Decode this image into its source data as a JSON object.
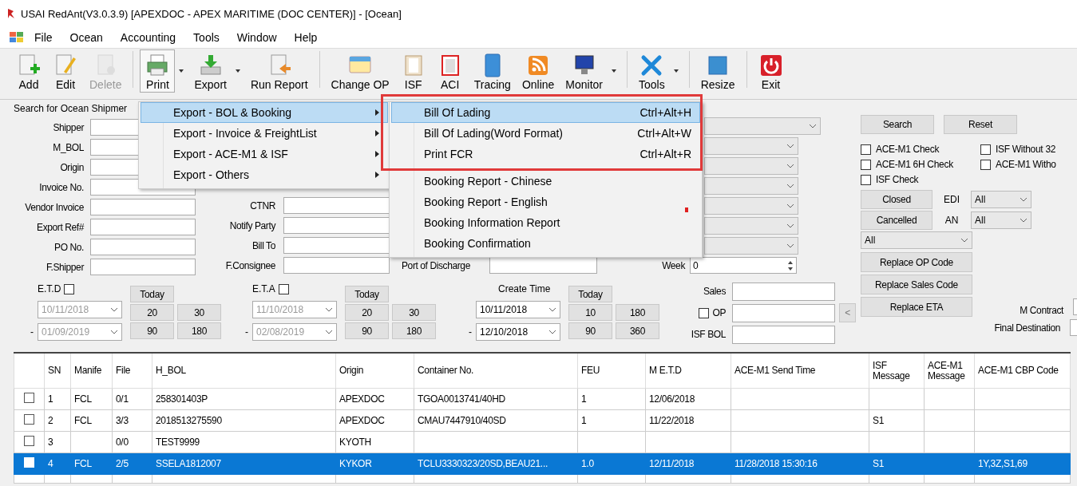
{
  "window": {
    "title": "USAI RedAnt(V3.0.3.9) [APEXDOC - APEX MARITIME (DOC CENTER)] - [Ocean]"
  },
  "menu_bar": [
    "File",
    "Ocean",
    "Accounting",
    "Tools",
    "Window",
    "Help"
  ],
  "toolbar": [
    {
      "label": "Add",
      "disabled": false,
      "pressed": false,
      "dropdown": false
    },
    {
      "label": "Edit",
      "disabled": false,
      "pressed": false,
      "dropdown": false
    },
    {
      "label": "Delete",
      "disabled": true,
      "pressed": false,
      "dropdown": false
    },
    {
      "label": "Print",
      "disabled": false,
      "pressed": true,
      "dropdown": true
    },
    {
      "label": "Export",
      "disabled": false,
      "pressed": false,
      "dropdown": true
    },
    {
      "label": "Run Report",
      "disabled": false,
      "pressed": false,
      "dropdown": false
    },
    {
      "label": "Change OP",
      "disabled": false,
      "pressed": false,
      "dropdown": false
    },
    {
      "label": "ISF",
      "disabled": false,
      "pressed": false,
      "dropdown": false
    },
    {
      "label": "ACI",
      "disabled": false,
      "pressed": false,
      "dropdown": false
    },
    {
      "label": "Tracing",
      "disabled": false,
      "pressed": false,
      "dropdown": false
    },
    {
      "label": "Online",
      "disabled": false,
      "pressed": false,
      "dropdown": false
    },
    {
      "label": "Monitor",
      "disabled": false,
      "pressed": false,
      "dropdown": true
    },
    {
      "label": "Tools",
      "disabled": false,
      "pressed": false,
      "dropdown": true
    },
    {
      "label": "Resize",
      "disabled": false,
      "pressed": false,
      "dropdown": false
    },
    {
      "label": "Exit",
      "disabled": false,
      "pressed": false,
      "dropdown": false
    }
  ],
  "search_form": {
    "title": "Search for Ocean Shipmer",
    "left_fields": [
      "Shipper",
      "M_BOL",
      "Origin",
      "Invoice No.",
      "Vendor Invoice",
      "Export Ref#",
      "PO No.",
      "F.Shipper"
    ],
    "middle_fields": [
      "CTNR",
      "Notify Party",
      "Bill To",
      "F.Consignee"
    ],
    "port_of_discharge": "Port of Discharge",
    "week": {
      "label": "Week",
      "value": "0"
    },
    "date_groups": [
      {
        "kind": "checkbox",
        "label": "E.T.D",
        "checked": false,
        "disabled": true,
        "from": "10/11/2018",
        "separator": "-",
        "to": "01/09/2019",
        "quick": [
          "Today",
          "20",
          "30",
          "90",
          "180"
        ]
      },
      {
        "kind": "checkbox",
        "label": "E.T.A",
        "checked": false,
        "disabled": true,
        "from": "11/10/2018",
        "separator": "-",
        "to": "02/08/2019",
        "quick": [
          "Today",
          "20",
          "30",
          "90",
          "180"
        ]
      },
      {
        "kind": "label",
        "label": "Create Time",
        "disabled": false,
        "from": "10/11/2018",
        "separator": "-",
        "to": "12/10/2018",
        "quick": [
          "Today",
          "10",
          "180",
          "90",
          "360"
        ]
      }
    ],
    "sales_fields": [
      {
        "kind": "text",
        "label": "Sales"
      },
      {
        "kind": "checkbox",
        "label": "OP",
        "checked": false
      },
      {
        "kind": "text",
        "label": "ISF BOL"
      }
    ],
    "shift_button": "<"
  },
  "right_panel": {
    "buttons": [
      "Search",
      "Reset"
    ],
    "checks": [
      {
        "label": "ACE-M1 Check",
        "checked": false
      },
      {
        "label": "ISF Without 32",
        "checked": false
      },
      {
        "label": "ACE-M1 6H Check",
        "checked": false
      },
      {
        "label": "ACE-M1 Witho",
        "checked": false
      },
      {
        "label": "ISF Check",
        "checked": false
      }
    ],
    "status_rows": [
      {
        "button": "Closed",
        "label": "EDI",
        "value": "All"
      },
      {
        "button": "Cancelled",
        "label": "AN",
        "value": "All"
      }
    ],
    "combo_value": "All",
    "replace_buttons": [
      "Replace OP Code",
      "Replace Sales Code",
      "Replace ETA"
    ],
    "m_contract": "M Contract",
    "final_destination": "Final Destination"
  },
  "table": {
    "columns": [
      "SN",
      "Manife",
      "File",
      "H_BOL",
      "Origin",
      "Container No.",
      "FEU",
      "M E.T.D",
      "ACE-M1 Send Time",
      "ISF Message",
      "ACE-M1 Message",
      "ACE-M1 CBP Code"
    ],
    "rows": [
      {
        "checked": false,
        "selected": false,
        "cells": [
          "1",
          "FCL",
          "0/1",
          "258301403P",
          "APEXDOC",
          "TGOA0013741/40HD",
          "1",
          "12/06/2018",
          "",
          "",
          "",
          ""
        ]
      },
      {
        "checked": false,
        "selected": false,
        "cells": [
          "2",
          "FCL",
          "3/3",
          "2018513275590",
          "APEXDOC",
          "CMAU7447910/40SD",
          "1",
          "11/22/2018",
          "",
          "S1",
          "",
          ""
        ]
      },
      {
        "checked": false,
        "selected": false,
        "cells": [
          "3",
          "",
          "0/0",
          "TEST9999",
          "KYOTH",
          "",
          "",
          "",
          "",
          "",
          "",
          ""
        ]
      },
      {
        "checked": false,
        "selected": true,
        "cells": [
          "4",
          "FCL",
          "2/5",
          "SSELA1812007",
          "KYKOR",
          "TCLU3330323/20SD,BEAU21...",
          "1.0",
          "12/11/2018",
          "11/28/2018 15:30:16",
          "S1",
          "",
          "1Y,3Z,S1,69"
        ]
      }
    ]
  },
  "print_menu": {
    "items": [
      {
        "label": "Export - BOL & Booking",
        "selected": true
      },
      {
        "label": "Export - Invoice & FreightList",
        "selected": false
      },
      {
        "label": "Export - ACE-M1 & ISF",
        "selected": false
      },
      {
        "label": "Export - Others",
        "selected": false
      }
    ],
    "submenu": [
      {
        "label": "Bill Of Lading",
        "shortcut": "Ctrl+Alt+H",
        "selected": true
      },
      {
        "label": "Bill Of Lading(Word Format)",
        "shortcut": "Ctrl+Alt+W",
        "selected": false
      },
      {
        "label": "Print FCR",
        "shortcut": "Ctrl+Alt+R",
        "selected": false
      },
      {
        "label": "Booking Report - Chinese",
        "selected": false
      },
      {
        "label": "Booking Report - English",
        "selected": false
      },
      {
        "label": "Booking Information Report",
        "selected": false
      },
      {
        "label": "Booking Confirmation",
        "selected": false
      }
    ]
  },
  "annotation": {
    "highlight_box": true,
    "dot": true
  }
}
